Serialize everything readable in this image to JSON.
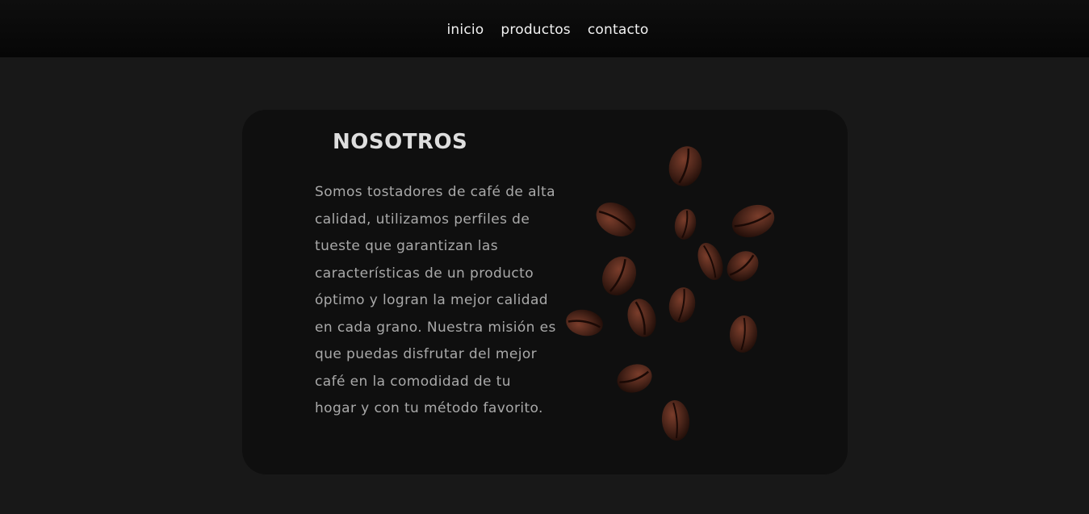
{
  "nav": {
    "items": [
      {
        "label": "inicio"
      },
      {
        "label": "productos"
      },
      {
        "label": "contacto"
      }
    ]
  },
  "about": {
    "title": "NOSOTROS",
    "body": "Somos tostadores de café de alta calidad, utilizamos perfiles de tueste que garantizan las características de un producto óptimo y logran la mejor calidad en cada grano. Nuestra misión es que puedas disfrutar del mejor café en la comodidad de tu hogar y con tu método favorito."
  },
  "colors": {
    "page_background": "#181818",
    "navbar_background": "#070707",
    "card_background": "#0f0f0f",
    "title": "#dedede",
    "body_text": "#a9a9a9",
    "bean": "#4a2419"
  },
  "image": {
    "name": "coffee-beans-image"
  }
}
